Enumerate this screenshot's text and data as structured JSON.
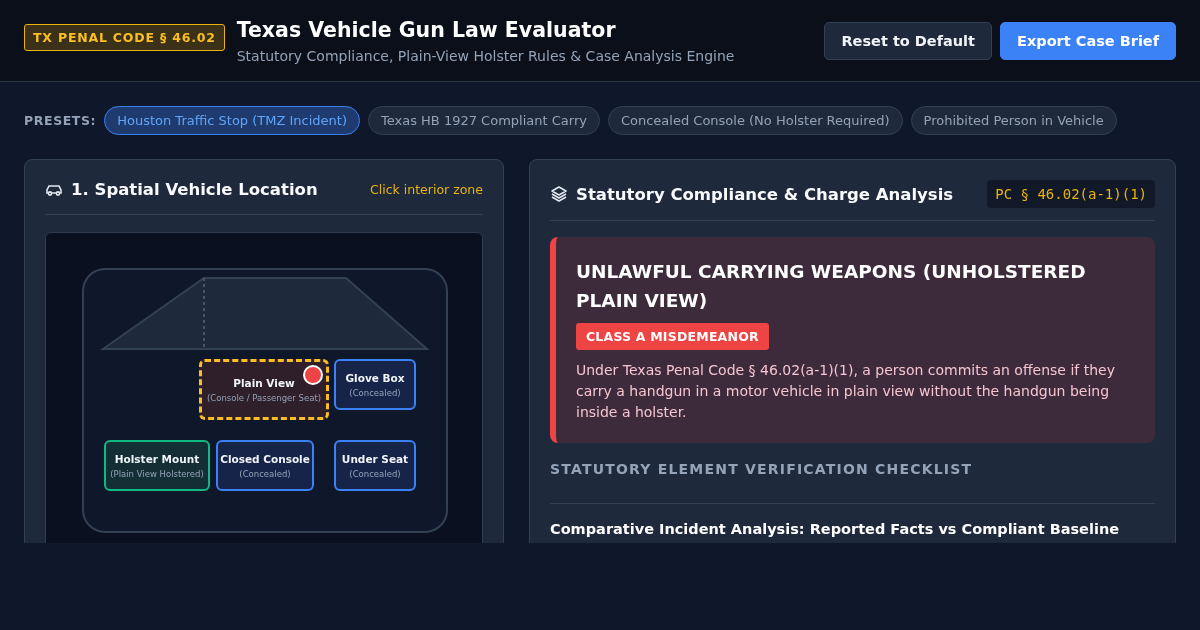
{
  "header": {
    "badge": "TX PENAL CODE § 46.02",
    "title": "Texas Vehicle Gun Law Evaluator",
    "subtitle": "Statutory Compliance, Plain-View Holster Rules & Case Analysis Engine",
    "buttons": [
      {
        "label": "Reset to Default",
        "kind": "secondary"
      },
      {
        "label": "Export Case Brief",
        "kind": "primary"
      }
    ]
  },
  "presets": {
    "label": "PRESETS:",
    "items": [
      {
        "label": "Houston Traffic Stop (TMZ Incident)",
        "selected": true
      },
      {
        "label": "Texas HB 1927 Compliant Carry",
        "selected": false
      },
      {
        "label": "Concealed Console (No Holster Required)",
        "selected": false
      },
      {
        "label": "Prohibited Person in Vehicle",
        "selected": false
      }
    ]
  },
  "vehicle_panel": {
    "title": "1. Spatial Vehicle Location",
    "hint": "Click interior zone",
    "zones": [
      {
        "label": "Plain View",
        "note": "(Console / Passenger Seat)",
        "kind": "plain",
        "selected": true
      },
      {
        "label": "Glove Box",
        "note": "(Concealed)",
        "kind": "concealed",
        "selected": false
      },
      {
        "label": "Holster Mount",
        "note": "(Plain View Holstered)",
        "kind": "holstered",
        "selected": false
      },
      {
        "label": "Closed Console",
        "note": "(Concealed)",
        "kind": "concealed",
        "selected": false
      },
      {
        "label": "Under Seat",
        "note": "(Concealed)",
        "kind": "concealed",
        "selected": false
      }
    ]
  },
  "analysis_panel": {
    "title": "Statutory Compliance & Charge Analysis",
    "code": "PC § 46.02(a-1)(1)",
    "verdict": {
      "kind": "violation",
      "title": "UNLAWFUL CARRYING WEAPONS (UNHOLSTERED PLAIN VIEW)",
      "charge": "CLASS A MISDEMEANOR",
      "text": "Under Texas Penal Code § 46.02(a-1)(1), a person commits an offense if they carry a handgun in a motor vehicle in plain view without the handgun being inside a holster."
    },
    "checklist_title": "STATUTORY ELEMENT VERIFICATION CHECKLIST",
    "comparison_title": "Comparative Incident Analysis: Reported Facts vs Compliant Baseline"
  }
}
